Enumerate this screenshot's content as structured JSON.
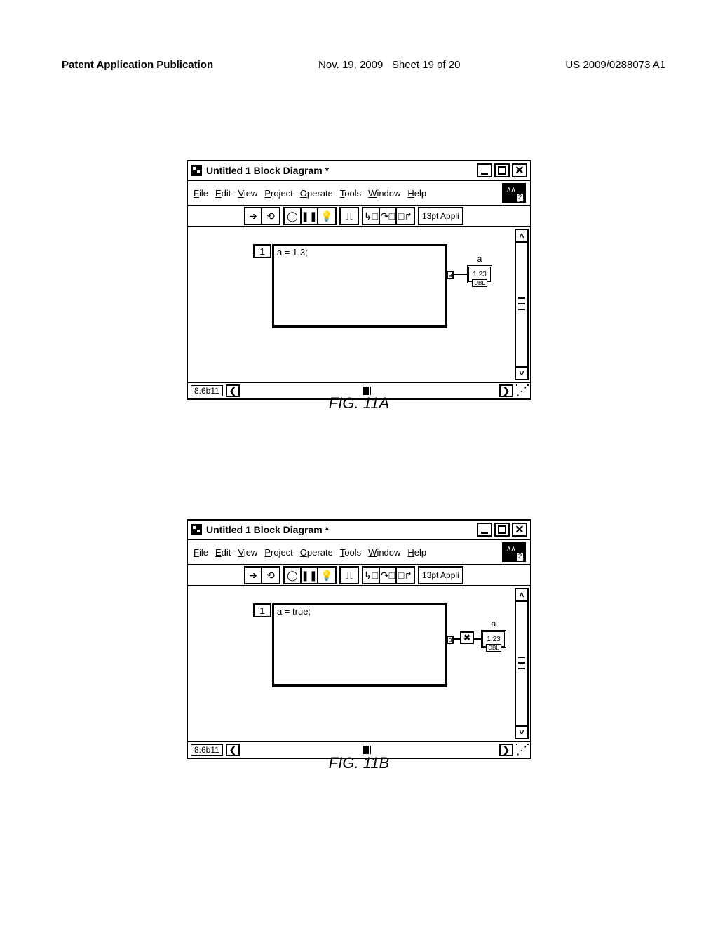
{
  "header": {
    "pub": "Patent Application Publication",
    "date": "Nov. 19, 2009",
    "sheet": "Sheet 19 of 20",
    "pubnum": "US 2009/0288073 A1"
  },
  "figures": {
    "a_label": "FIG. 11A",
    "b_label": "FIG. 11B"
  },
  "window": {
    "title": "Untitled 1 Block Diagram *",
    "menus": [
      "File",
      "Edit",
      "View",
      "Project",
      "Operate",
      "Tools",
      "Window",
      "Help"
    ],
    "font": "13pt Appli",
    "ctx_help_num": "2",
    "version": "8.6b11"
  },
  "figA": {
    "node_index": "1",
    "code": "a = 1.3;",
    "output_terminal": "a",
    "ind_label": "a",
    "ind_value": "1.23",
    "ind_type": "DBL"
  },
  "figB": {
    "node_index": "1",
    "code": "a = true;",
    "output_terminal": "a",
    "ind_label": "a",
    "ind_value": "1.23",
    "ind_type": "DBL",
    "error_glyph": "✖"
  }
}
